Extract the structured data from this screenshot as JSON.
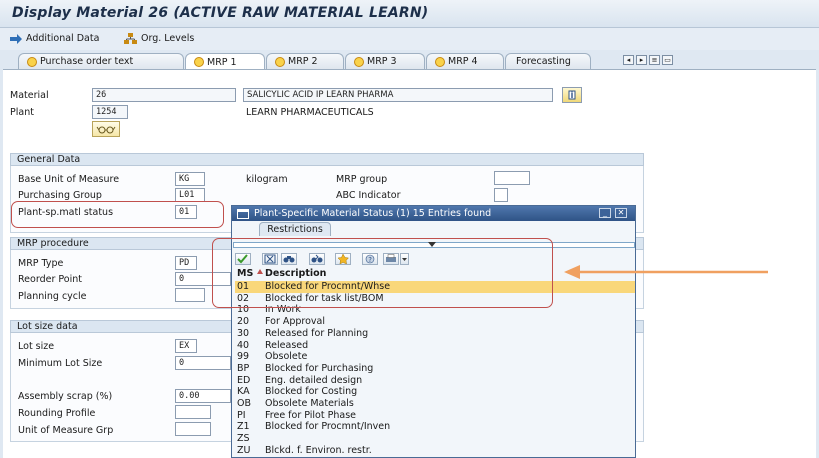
{
  "window": {
    "title": "Display Material 26 (ACTIVE RAW MATERIAL LEARN)"
  },
  "toolbar": {
    "additional_data": "Additional Data",
    "org_levels": "Org. Levels"
  },
  "tabs": [
    {
      "label": "Purchase order text"
    },
    {
      "label": "MRP 1"
    },
    {
      "label": "MRP 2"
    },
    {
      "label": "MRP 3"
    },
    {
      "label": "MRP 4"
    },
    {
      "label": "Forecasting"
    }
  ],
  "header": {
    "material_label": "Material",
    "material_value": "26",
    "material_desc": "SALICYLIC ACID IP LEARN PHARMA",
    "plant_label": "Plant",
    "plant_value": "1254",
    "plant_desc": "LEARN PHARMACEUTICALS"
  },
  "general": {
    "title": "General Data",
    "base_uom_label": "Base Unit of Measure",
    "base_uom_value": "KG",
    "base_uom_text": "kilogram",
    "mrp_group_label": "MRP group",
    "purch_group_label": "Purchasing Group",
    "purch_group_value": "L01",
    "abc_label": "ABC Indicator",
    "status_label": "Plant-sp.matl status",
    "status_value": "01"
  },
  "mrp_proc": {
    "title": "MRP procedure",
    "type_label": "MRP Type",
    "type_value": "PD",
    "reorder_label": "Reorder Point",
    "reorder_value": "0",
    "cycle_label": "Planning cycle"
  },
  "lot": {
    "title": "Lot size data",
    "lot_label": "Lot size",
    "lot_value": "EX",
    "min_label": "Minimum Lot Size",
    "min_value": "0",
    "scrap_label": "Assembly scrap (%)",
    "scrap_value": "0.00",
    "rounding_label": "Rounding Profile",
    "uom_grp_label": "Unit of Measure Grp"
  },
  "popup": {
    "title": "Plant-Specific Material Status (1)   15 Entries found",
    "restrictions_tab": "Restrictions",
    "col_ms": "MS",
    "col_desc": "Description",
    "rows": [
      {
        "code": "01",
        "desc": "Blocked for Procmnt/Whse"
      },
      {
        "code": "02",
        "desc": "Blocked for task list/BOM"
      },
      {
        "code": "10",
        "desc": "In Work"
      },
      {
        "code": "20",
        "desc": "For Approval"
      },
      {
        "code": "30",
        "desc": "Released for Planning"
      },
      {
        "code": "40",
        "desc": "Released"
      },
      {
        "code": "99",
        "desc": "Obsolete"
      },
      {
        "code": "BP",
        "desc": "Blocked for Purchasing"
      },
      {
        "code": "ED",
        "desc": "Eng. detailed design"
      },
      {
        "code": "KA",
        "desc": "Blocked for Costing"
      },
      {
        "code": "OB",
        "desc": "Obsolete Materials"
      },
      {
        "code": "PI",
        "desc": "Free for Pilot Phase"
      },
      {
        "code": "Z1",
        "desc": "Blocked for Procmnt/Inven"
      },
      {
        "code": "ZS",
        "desc": ""
      },
      {
        "code": "ZU",
        "desc": "Blckd. f. Environ. restr."
      }
    ]
  },
  "colors": {
    "callout": "#c0504d",
    "arrow": "#f0a060",
    "popup_title": "#2f5386",
    "selected_row": "#f9d77a"
  }
}
